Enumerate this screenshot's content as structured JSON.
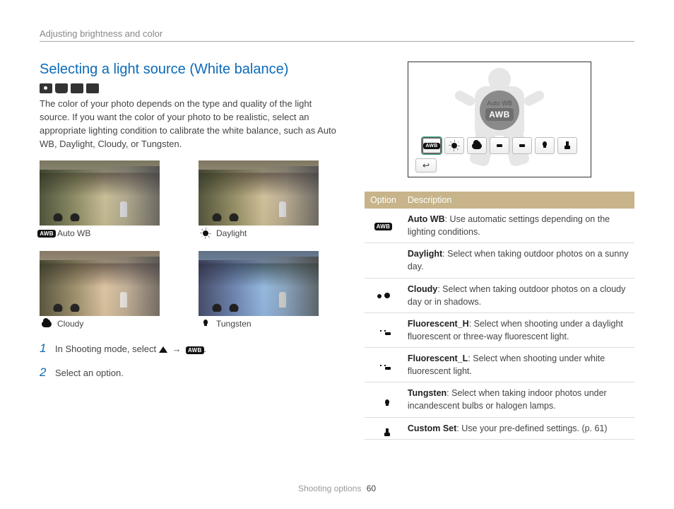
{
  "header": {
    "section": "Adjusting brightness and color"
  },
  "heading": "Selecting a light source (White balance)",
  "intro": "The color of your photo depends on the type and quality of the light source. If you want the color of your photo to be realistic, select an appropriate lighting condition to calibrate the white balance, such as Auto WB, Daylight, Cloudy, or Tungsten.",
  "samples": {
    "0": {
      "label": "Auto WB"
    },
    "1": {
      "label": "Daylight"
    },
    "2": {
      "label": "Cloudy"
    },
    "3": {
      "label": "Tungsten"
    }
  },
  "steps": {
    "0": {
      "num": "1",
      "text_a": "In Shooting mode, select",
      "text_b": "."
    },
    "1": {
      "num": "2",
      "text": "Select an option."
    }
  },
  "screen": {
    "selected_label": "Auto WB",
    "selected_code": "AWB"
  },
  "table": {
    "headers": {
      "opt": "Option",
      "desc": "Description"
    },
    "rows": {
      "0": {
        "name": "Auto WB",
        "desc": ": Use automatic settings depending on the lighting conditions."
      },
      "1": {
        "name": "Daylight",
        "desc": ": Select when taking outdoor photos on a sunny day."
      },
      "2": {
        "name": "Cloudy",
        "desc": ": Select when taking outdoor photos on a cloudy day or in shadows."
      },
      "3": {
        "name": "Fluorescent_H",
        "desc": ": Select when shooting under a daylight fluorescent or three-way fluorescent light."
      },
      "4": {
        "name": "Fluorescent_L",
        "desc": ": Select when shooting under white fluorescent light."
      },
      "5": {
        "name": "Tungsten",
        "desc": ": Select when taking indoor photos under incandescent bulbs or halogen lamps."
      },
      "6": {
        "name": "Custom Set",
        "desc": ": Use your pre-defined settings. (p. 61)"
      }
    }
  },
  "footer": {
    "section": "Shooting options",
    "page": "60"
  }
}
